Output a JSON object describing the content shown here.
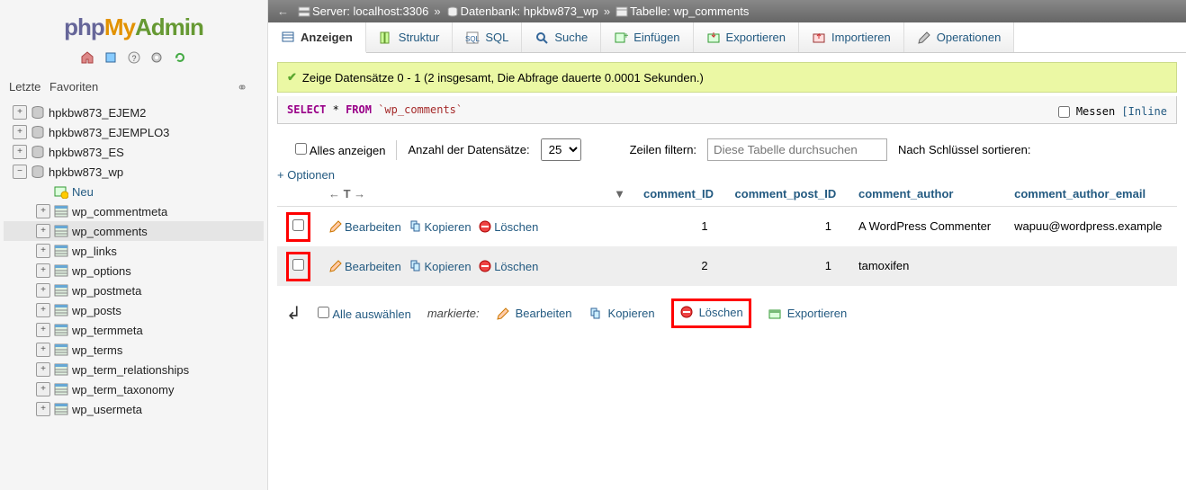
{
  "logo": {
    "p1": "php",
    "p2": "My",
    "p3": "Admin"
  },
  "sidebar": {
    "recent": "Letzte",
    "favorites": "Favoriten",
    "dbs": [
      {
        "name": "hpkbw873_EJEM2",
        "expanded": false
      },
      {
        "name": "hpkbw873_EJEMPLO3",
        "expanded": false
      },
      {
        "name": "hpkbw873_ES",
        "expanded": false
      },
      {
        "name": "hpkbw873_wp",
        "expanded": true
      }
    ],
    "newLabel": "Neu",
    "tables": [
      "wp_commentmeta",
      "wp_comments",
      "wp_links",
      "wp_options",
      "wp_postmeta",
      "wp_posts",
      "wp_termmeta",
      "wp_terms",
      "wp_term_relationships",
      "wp_term_taxonomy",
      "wp_usermeta"
    ],
    "selectedTable": "wp_comments"
  },
  "breadcrumb": {
    "serverLabel": "Server:",
    "serverValue": "localhost:3306",
    "dbLabel": "Datenbank:",
    "dbValue": "hpkbw873_wp",
    "tableLabel": "Tabelle:",
    "tableValue": "wp_comments"
  },
  "tabs": [
    "Anzeigen",
    "Struktur",
    "SQL",
    "Suche",
    "Einfügen",
    "Exportieren",
    "Importieren",
    "Operationen"
  ],
  "activeTab": 0,
  "success": "Zeige Datensätze 0 - 1 (2 insgesamt, Die Abfrage dauerte 0.0001 Sekunden.)",
  "sql": {
    "select": "SELECT",
    "star": "*",
    "from": "FROM",
    "table": "`wp_comments`"
  },
  "sqlRight": {
    "measure": "Messen",
    "inline": "[Inline"
  },
  "controls": {
    "showAll": "Alles anzeigen",
    "rowCountLabel": "Anzahl der Datensätze:",
    "rowCountValue": "25",
    "filterLabel": "Zeilen filtern:",
    "filterPlaceholder": "Diese Tabelle durchsuchen",
    "sortLabel": "Nach Schlüssel sortieren:"
  },
  "optionsLink": "+ Optionen",
  "columns": [
    "comment_ID",
    "comment_post_ID",
    "comment_author",
    "comment_author_email"
  ],
  "rowActions": {
    "edit": "Bearbeiten",
    "copy": "Kopieren",
    "delete": "Löschen"
  },
  "rows": [
    {
      "id": "1",
      "post": "1",
      "author": "A WordPress Commenter",
      "email": "wapuu@wordpress.example"
    },
    {
      "id": "2",
      "post": "1",
      "author": "tamoxifen",
      "email": ""
    }
  ],
  "footer": {
    "checkAll": "Alle auswählen",
    "withSelected": "markierte:",
    "edit": "Bearbeiten",
    "copy": "Kopieren",
    "delete": "Löschen",
    "export": "Exportieren"
  }
}
